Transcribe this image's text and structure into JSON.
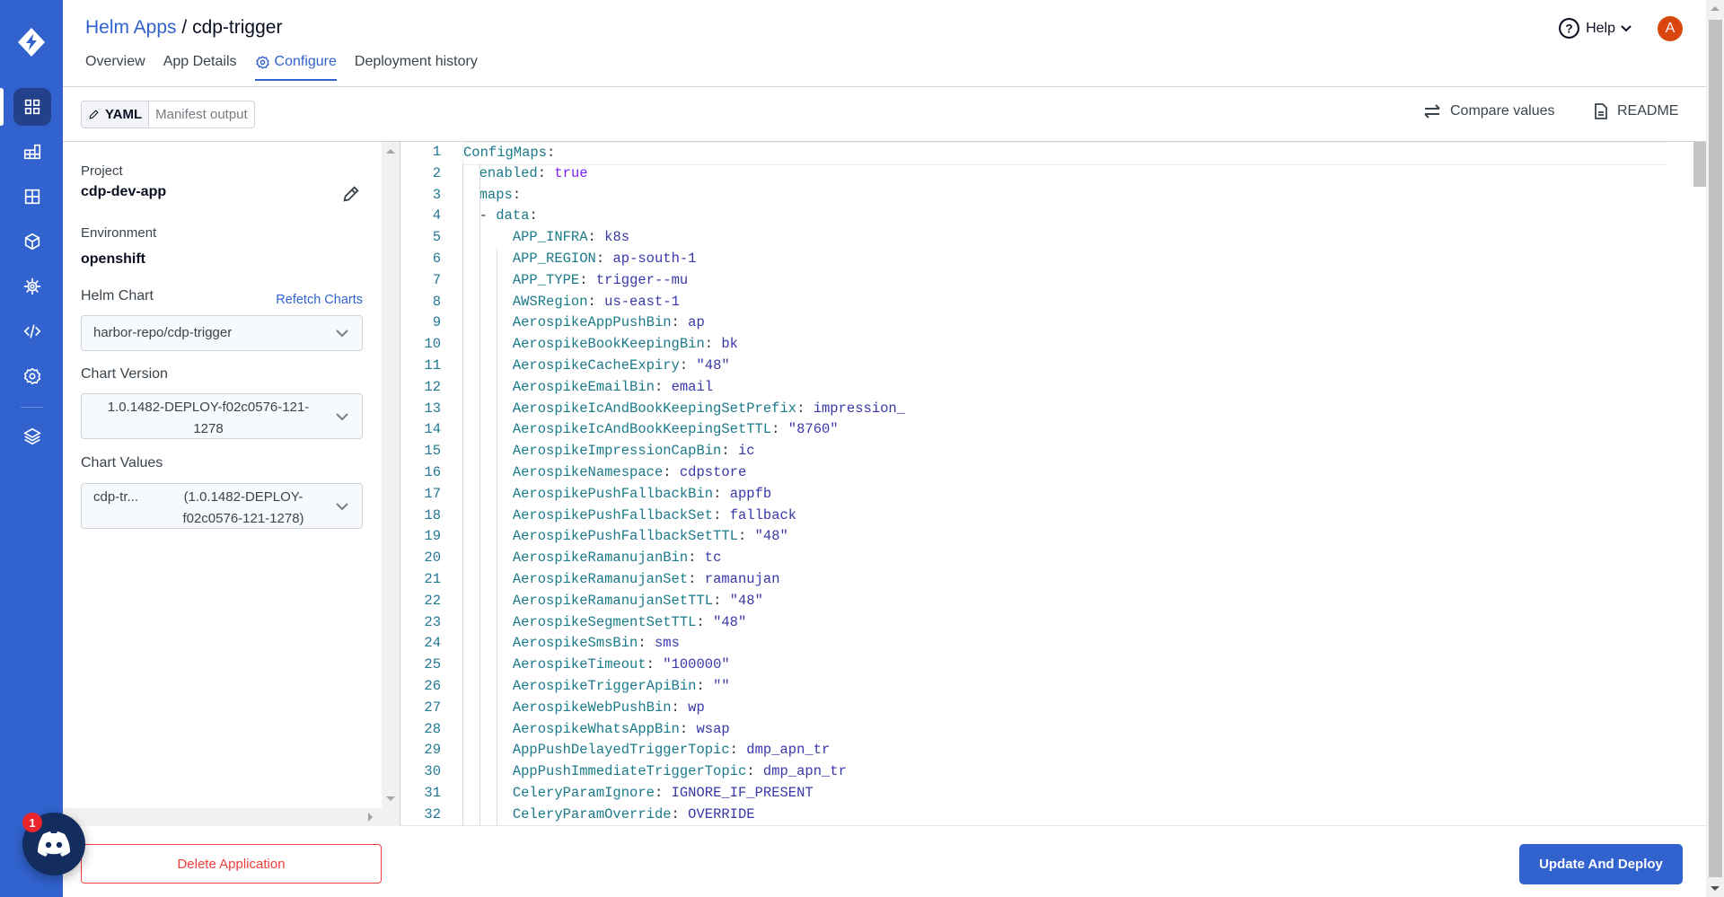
{
  "header": {
    "breadcrumb_parent": "Helm Apps",
    "separator": " / ",
    "app_name": "cdp-trigger",
    "help_label": "Help",
    "avatar_initial": "A"
  },
  "tabs": [
    {
      "label": "Overview"
    },
    {
      "label": "App Details"
    },
    {
      "label": "Configure"
    },
    {
      "label": "Deployment history"
    }
  ],
  "toolbar": {
    "yaml_label": "YAML",
    "manifest_label": "Manifest output",
    "compare_label": "Compare values",
    "readme_label": "README"
  },
  "left_panel": {
    "project_label": "Project",
    "project_value": "cdp-dev-app",
    "environment_label": "Environment",
    "environment_value": "openshift",
    "helm_chart_label": "Helm Chart",
    "refetch_label": "Refetch Charts",
    "helm_chart_value": "harbor-repo/cdp-trigger",
    "chart_version_label": "Chart Version",
    "chart_version_line1": "1.0.1482-DEPLOY-f02c0576-121-",
    "chart_version_line2": "1278",
    "chart_values_label": "Chart Values",
    "chart_values_name": "cdp-tr...",
    "chart_values_line1": "(1.0.1482-DEPLOY-",
    "chart_values_line2": "f02c0576-121-1278)",
    "delete_label": "Delete Application"
  },
  "discord": {
    "badge_count": "1"
  },
  "editor": {
    "lines": [
      {
        "n": "1",
        "indent": "",
        "key": "ConfigMaps",
        "value": "",
        "vt": "v"
      },
      {
        "n": "2",
        "indent": "  ",
        "key": "enabled",
        "value": "true",
        "vt": "b"
      },
      {
        "n": "3",
        "indent": "  ",
        "key": "maps",
        "value": "",
        "vt": "v"
      },
      {
        "n": "4",
        "indent": "  - ",
        "key": "data",
        "value": "",
        "vt": "v"
      },
      {
        "n": "5",
        "indent": "      ",
        "key": "APP_INFRA",
        "value": "k8s",
        "vt": "v"
      },
      {
        "n": "6",
        "indent": "      ",
        "key": "APP_REGION",
        "value": "ap-south-1",
        "vt": "v"
      },
      {
        "n": "7",
        "indent": "      ",
        "key": "APP_TYPE",
        "value": "trigger--mu",
        "vt": "v"
      },
      {
        "n": "8",
        "indent": "      ",
        "key": "AWSRegion",
        "value": "us-east-1",
        "vt": "v"
      },
      {
        "n": "9",
        "indent": "      ",
        "key": "AerospikeAppPushBin",
        "value": "ap",
        "vt": "v"
      },
      {
        "n": "10",
        "indent": "      ",
        "key": "AerospikeBookKeepingBin",
        "value": "bk",
        "vt": "v"
      },
      {
        "n": "11",
        "indent": "      ",
        "key": "AerospikeCacheExpiry",
        "value": "\"48\"",
        "vt": "v"
      },
      {
        "n": "12",
        "indent": "      ",
        "key": "AerospikeEmailBin",
        "value": "email",
        "vt": "v"
      },
      {
        "n": "13",
        "indent": "      ",
        "key": "AerospikeIcAndBookKeepingSetPrefix",
        "value": "impression_",
        "vt": "v"
      },
      {
        "n": "14",
        "indent": "      ",
        "key": "AerospikeIcAndBookKeepingSetTTL",
        "value": "\"8760\"",
        "vt": "v"
      },
      {
        "n": "15",
        "indent": "      ",
        "key": "AerospikeImpressionCapBin",
        "value": "ic",
        "vt": "v"
      },
      {
        "n": "16",
        "indent": "      ",
        "key": "AerospikeNamespace",
        "value": "cdpstore",
        "vt": "v"
      },
      {
        "n": "17",
        "indent": "      ",
        "key": "AerospikePushFallbackBin",
        "value": "appfb",
        "vt": "v"
      },
      {
        "n": "18",
        "indent": "      ",
        "key": "AerospikePushFallbackSet",
        "value": "fallback",
        "vt": "v"
      },
      {
        "n": "19",
        "indent": "      ",
        "key": "AerospikePushFallbackSetTTL",
        "value": "\"48\"",
        "vt": "v"
      },
      {
        "n": "20",
        "indent": "      ",
        "key": "AerospikeRamanujanBin",
        "value": "tc",
        "vt": "v"
      },
      {
        "n": "21",
        "indent": "      ",
        "key": "AerospikeRamanujanSet",
        "value": "ramanujan",
        "vt": "v"
      },
      {
        "n": "22",
        "indent": "      ",
        "key": "AerospikeRamanujanSetTTL",
        "value": "\"48\"",
        "vt": "v"
      },
      {
        "n": "23",
        "indent": "      ",
        "key": "AerospikeSegmentSetTTL",
        "value": "\"48\"",
        "vt": "v"
      },
      {
        "n": "24",
        "indent": "      ",
        "key": "AerospikeSmsBin",
        "value": "sms",
        "vt": "v"
      },
      {
        "n": "25",
        "indent": "      ",
        "key": "AerospikeTimeout",
        "value": "\"100000\"",
        "vt": "v"
      },
      {
        "n": "26",
        "indent": "      ",
        "key": "AerospikeTriggerApiBin",
        "value": "\"\"",
        "vt": "v"
      },
      {
        "n": "27",
        "indent": "      ",
        "key": "AerospikeWebPushBin",
        "value": "wp",
        "vt": "v"
      },
      {
        "n": "28",
        "indent": "      ",
        "key": "AerospikeWhatsAppBin",
        "value": "wsap",
        "vt": "v"
      },
      {
        "n": "29",
        "indent": "      ",
        "key": "AppPushDelayedTriggerTopic",
        "value": "dmp_apn_tr",
        "vt": "v"
      },
      {
        "n": "30",
        "indent": "      ",
        "key": "AppPushImmediateTriggerTopic",
        "value": "dmp_apn_tr",
        "vt": "v"
      },
      {
        "n": "31",
        "indent": "      ",
        "key": "CeleryParamIgnore",
        "value": "IGNORE_IF_PRESENT",
        "vt": "v"
      },
      {
        "n": "32",
        "indent": "      ",
        "key": "CeleryParamOverride",
        "value": "OVERRIDE",
        "vt": "v"
      }
    ]
  },
  "footer": {
    "update_label": "Update And Deploy"
  }
}
